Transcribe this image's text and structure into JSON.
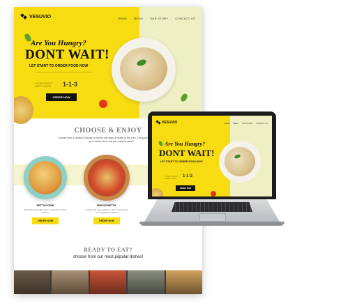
{
  "brand": {
    "name": "VESUVIO"
  },
  "nav": {
    "items": [
      "HOME",
      "MENU",
      "OUR STORY",
      "CONTACT US"
    ]
  },
  "hero": {
    "tagline": "Are You Hungry?",
    "headline": "DONT WAIT!",
    "subhead": "LET START TO ORDER FOOD NOW",
    "counter_label": "YOUR FOOD IS HAPPY SOON",
    "counter_value": "1-1-3",
    "cta": "ORDER NOW"
  },
  "choose": {
    "title": "CHOOSE & ENJOY",
    "desc": "Choose from a variety of dishes in stores, with taste & health at the core. The gourmet dish prepare your meals fresh. Are you ready to order?",
    "dishes": [
      {
        "name": "FETTUCCINE",
        "desc": "Make the pasta dish often served with creamy sauces",
        "button": "ORDER NOW"
      },
      {
        "name": "BRUSCHETTA",
        "desc": "A quick and easy appetizer, with a simple way to use garden tomatoes",
        "button": "ORDER NOW"
      }
    ]
  },
  "ready": {
    "title": "READY TO EAT?",
    "subtitle": "choose from our most popular dishes!"
  },
  "laptop": {
    "brand": "VESUVIO",
    "nav": [
      "HOME",
      "MENU",
      "OUR STORY",
      "CONTACT US"
    ],
    "tagline": "Are You Hungry?",
    "headline": "DONT WAIT!",
    "subhead": "LET START TO ORDER FOOD NOW",
    "counter_label": "YOUR FOOD IS HAPPY SOON",
    "counter_value": "1-1-3",
    "cta": "ORDER NOW"
  },
  "colors": {
    "accent_yellow": "#f7dc12",
    "pale_green": "#eef0c4",
    "dark": "#111111"
  }
}
